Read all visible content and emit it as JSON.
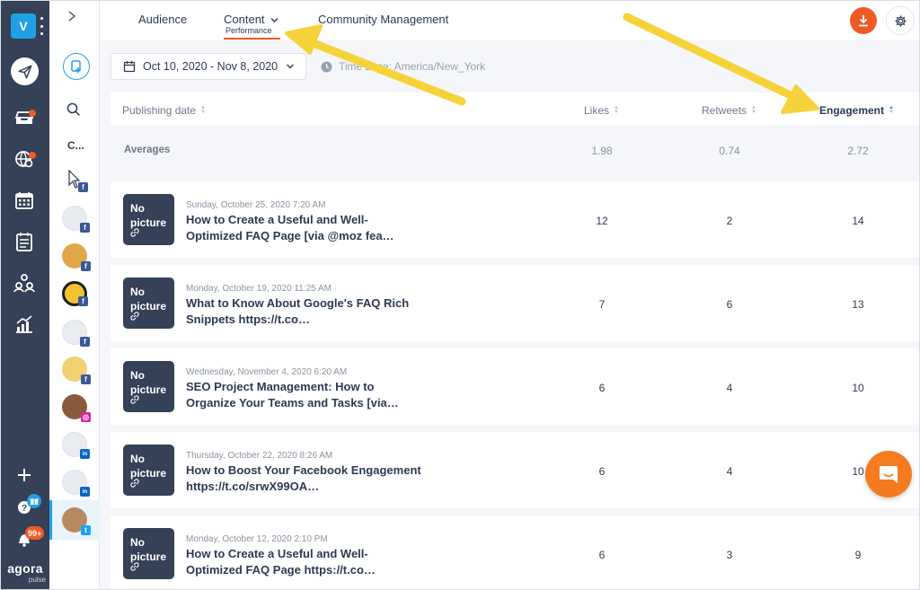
{
  "workspace": {
    "initial": "V"
  },
  "branding": {
    "logo": "agora",
    "sub": "pulse"
  },
  "sidebar": {
    "notifications_badge": "99+",
    "icons": [
      "send-icon",
      "inbox-icon",
      "monitor-globe-icon",
      "calendar-icon",
      "report-list-icon",
      "team-icon",
      "analytics-icon",
      "add-icon",
      "help-icon",
      "bell-icon"
    ]
  },
  "profiles": {
    "truncated_label": "C...",
    "networks": [
      "facebook",
      "facebook",
      "facebook",
      "facebook",
      "facebook",
      "facebook",
      "instagram",
      "linkedin",
      "linkedin",
      "twitter"
    ]
  },
  "nav": {
    "tabs": [
      {
        "label": "Audience"
      },
      {
        "label": "Content",
        "sublabel": "Performance"
      },
      {
        "label": "Community Management"
      }
    ]
  },
  "filters": {
    "date_range": "Oct 10, 2020 - Nov 8, 2020",
    "timezone": "Time zone: America/New_York"
  },
  "table": {
    "columns": [
      "Publishing date",
      "Likes",
      "Retweets",
      "Engagement"
    ],
    "averages_label": "Averages",
    "averages": {
      "likes": "1.98",
      "retweets": "0.74",
      "engagement": "2.72"
    },
    "thumb_label": "No picture",
    "rows": [
      {
        "date": "Sunday, October 25, 2020 7:20 AM",
        "title": "How to Create a Useful and Well-Optimized FAQ Page [via @moz fea…",
        "likes": "12",
        "retweets": "2",
        "engagement": "14"
      },
      {
        "date": "Monday, October 19, 2020 11:25 AM",
        "title": "What to Know About Google's FAQ Rich Snippets https://t.co…",
        "likes": "7",
        "retweets": "6",
        "engagement": "13"
      },
      {
        "date": "Wednesday, November 4, 2020 6:20 AM",
        "title": "SEO Project Management: How to Organize Your Teams and Tasks [via…",
        "likes": "6",
        "retweets": "4",
        "engagement": "10"
      },
      {
        "date": "Thursday, October 22, 2020 8:26 AM",
        "title": "How to Boost Your Facebook Engagement https://t.co/srwX99OA…",
        "likes": "6",
        "retweets": "4",
        "engagement": "10"
      },
      {
        "date": "Monday, October 12, 2020 2:10 PM",
        "title": "How to Create a Useful and Well-Optimized FAQ Page https://t.co…",
        "likes": "6",
        "retweets": "3",
        "engagement": "9"
      }
    ]
  },
  "colors": {
    "rail": "#344157",
    "accent_orange": "#f15a24",
    "accent_blue": "#22a0e6",
    "annotation_yellow": "#f6d23a"
  }
}
